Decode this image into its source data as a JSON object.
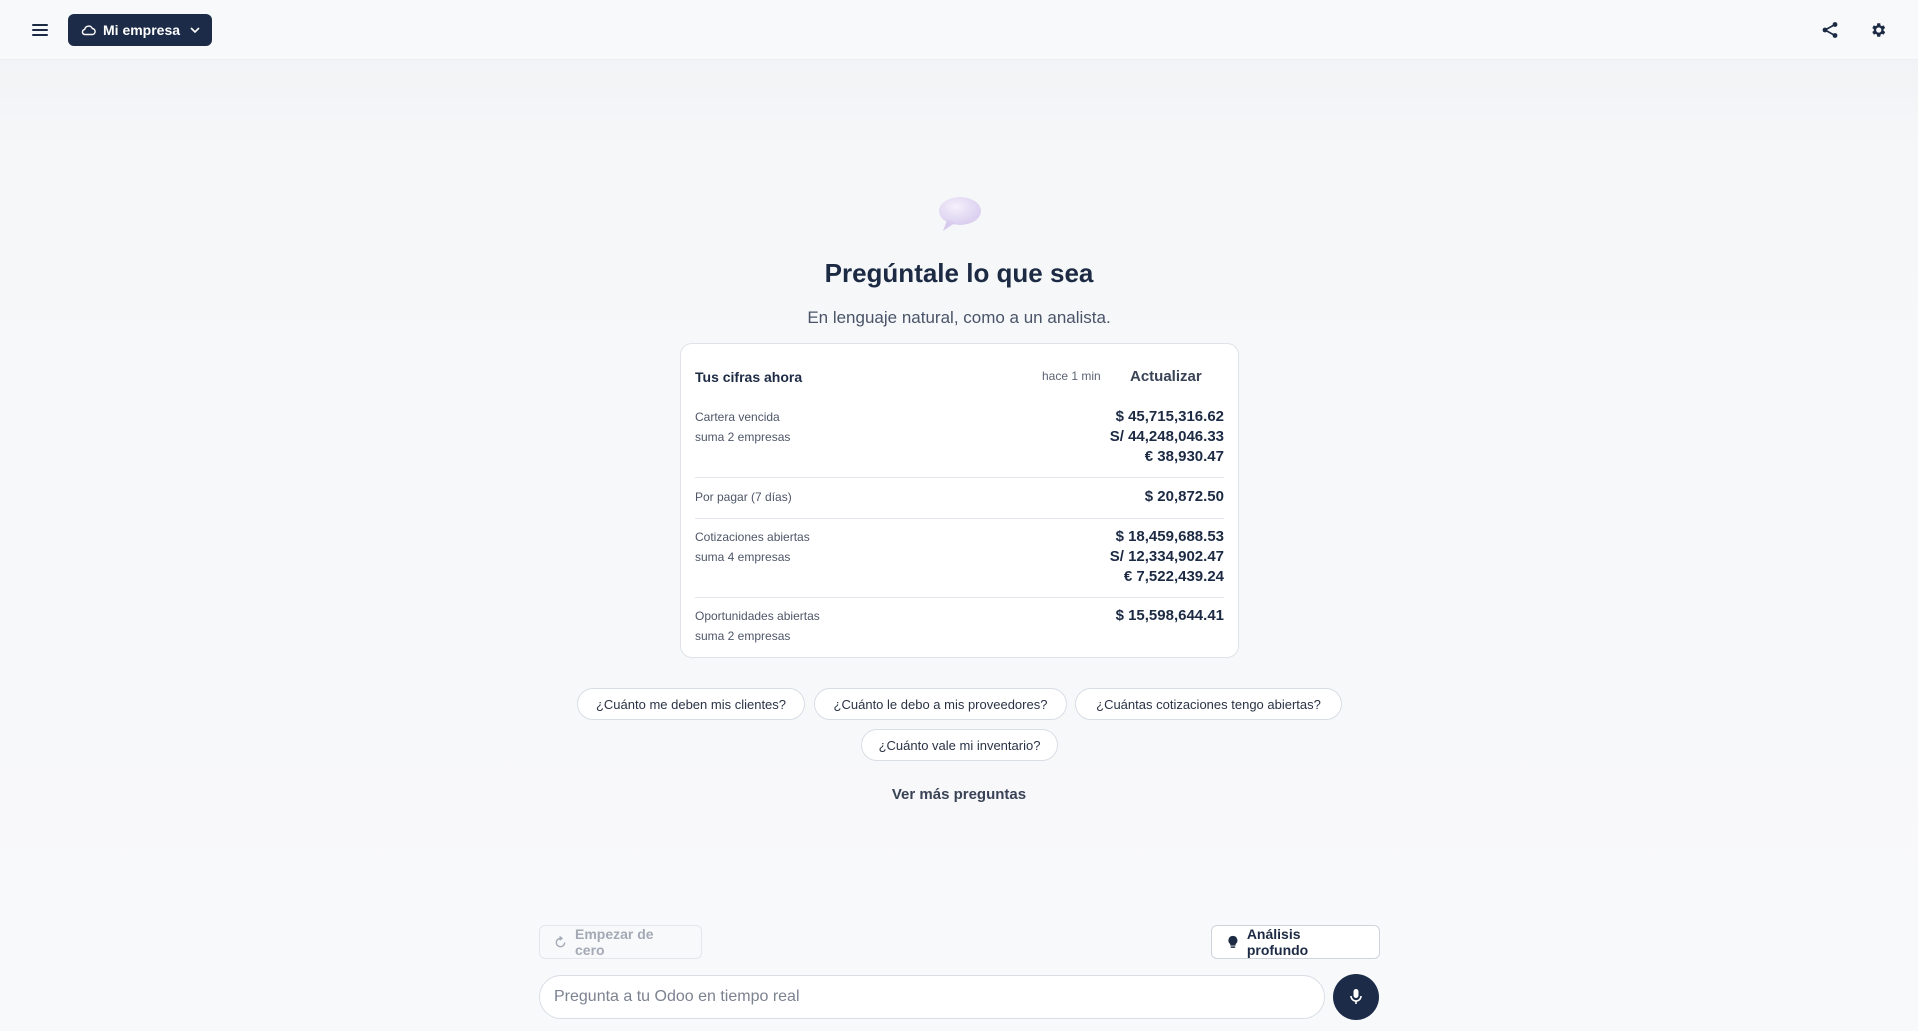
{
  "topbar": {
    "menu_icon": "hamburger-menu-icon",
    "company_label": "Mi empresa",
    "company_icon": "cloud-icon",
    "share_icon": "share-icon",
    "settings_icon": "gear-icon"
  },
  "hero": {
    "icon": "speech-bubble-icon",
    "title": "Pregúntale lo que sea",
    "subtitle": "En lenguaje natural, como a un analista."
  },
  "summary": {
    "title": "Tus cifras ahora",
    "updated": "hace 1 min",
    "refresh_label": "Actualizar",
    "metrics": [
      {
        "label": "Cartera vencida",
        "sublabel": "suma 2 empresas",
        "values": [
          "$ 45,715,316.62",
          "S/ 44,248,046.33",
          "€ 38,930.47"
        ]
      },
      {
        "label": "Por pagar (7 días)",
        "sublabel": "",
        "values": [
          "$ 20,872.50"
        ]
      },
      {
        "label": "Cotizaciones abiertas",
        "sublabel": "suma 4 empresas",
        "values": [
          "$ 18,459,688.53",
          "S/ 12,334,902.47",
          "€ 7,522,439.24"
        ]
      },
      {
        "label": "Oportunidades abiertas",
        "sublabel": "suma 2 empresas",
        "values": [
          "$ 15,598,644.41"
        ]
      }
    ]
  },
  "suggestions": [
    "¿Cuánto me deben mis clientes?",
    "¿Cuánto le debo a mis proveedores?",
    "¿Cuántas cotizaciones tengo abiertas?",
    "¿Cuánto vale mi inventario?"
  ],
  "more_questions_label": "Ver más preguntas",
  "composer": {
    "reset_label": "Empezar de cero",
    "deep_label": "Análisis profundo",
    "input_placeholder": "Pregunta a tu Odoo en tiempo real",
    "input_value": "",
    "mic_icon": "microphone-icon"
  },
  "colors": {
    "brand": "#1c2c48",
    "hero_bubble": "#e4dcf4"
  }
}
